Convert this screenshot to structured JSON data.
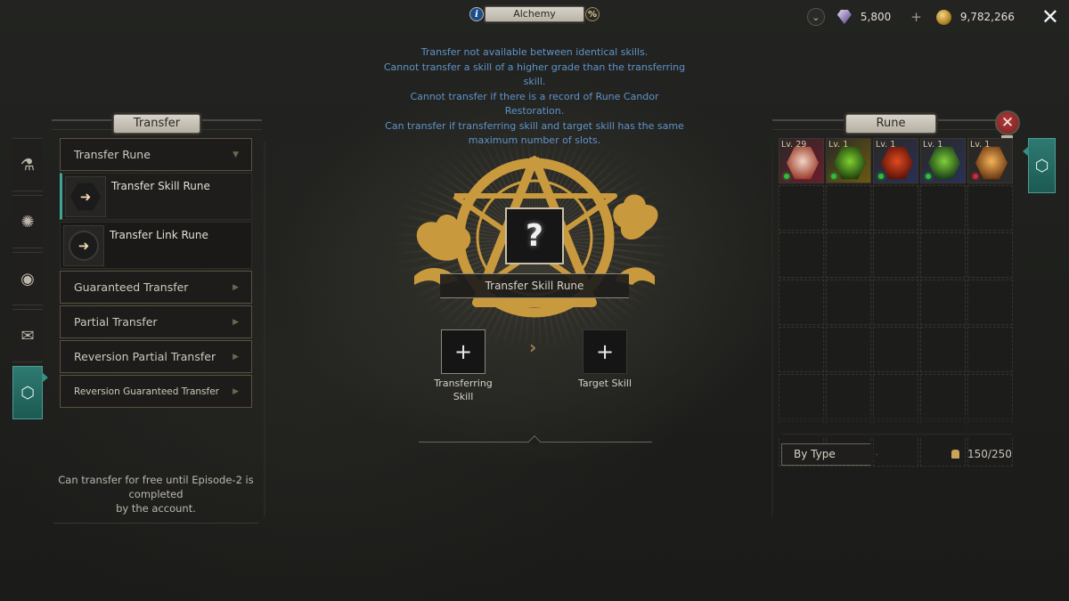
{
  "window": {
    "title": "Alchemy",
    "info_icon": "info-icon",
    "percent_icon": "percent-icon"
  },
  "currency": {
    "expand_icon": "chevron-down-icon",
    "gems": {
      "icon": "purple-gem-icon",
      "value": "5,800"
    },
    "add_label": "+",
    "gold": {
      "icon": "gold-coin-icon",
      "value": "9,782,266"
    },
    "close_label": "✕"
  },
  "notice": {
    "lines": [
      "Transfer not available between identical skills.",
      "Cannot transfer a skill of a higher grade than the transferring skill.",
      "Cannot transfer if there is a record of Rune Candor Restoration.",
      "Can transfer if transferring skill and target skill has the same maximum number of slots."
    ],
    "color": "#5f93c9"
  },
  "left_panel": {
    "title": "Transfer",
    "side_tabs": [
      {
        "name": "potion",
        "icon": "potion-icon",
        "glyph": "⚗",
        "active": false
      },
      {
        "name": "sun-rune",
        "icon": "sun-emblem-icon",
        "glyph": "✺",
        "active": false
      },
      {
        "name": "orb",
        "icon": "crystal-ball-icon",
        "glyph": "◉",
        "active": false
      },
      {
        "name": "scroll",
        "icon": "scroll-icon",
        "glyph": "✉",
        "active": false
      },
      {
        "name": "transfer",
        "icon": "transfer-hex-icon",
        "glyph": "⬡",
        "active": true
      }
    ],
    "category": {
      "label": "Transfer Rune",
      "arrow": "▼"
    },
    "sub_items": [
      {
        "label": "Transfer Skill Rune",
        "icon": "hex-arrow-icon",
        "glyph": "➜",
        "selected": true
      },
      {
        "label": "Transfer Link Rune",
        "icon": "round-arrow-icon",
        "glyph": "➜",
        "selected": false
      }
    ],
    "menu_items": [
      {
        "label": "Guaranteed Transfer",
        "arrow": "▶"
      },
      {
        "label": "Partial Transfer",
        "arrow": "▶"
      },
      {
        "label": "Reversion Partial Transfer",
        "arrow": "▶"
      },
      {
        "label": "Reversion Guaranteed Transfer",
        "arrow": "▶"
      }
    ],
    "free_note": [
      "Can transfer for free until Episode-2 is",
      "completed",
      "by the account."
    ]
  },
  "center": {
    "result_placeholder": "?",
    "result_name": "Transfer Skill Rune",
    "transferring_slot": {
      "label_lines": [
        "Transferring",
        "Skill"
      ],
      "plus": "+"
    },
    "arrow": "›",
    "target_slot": {
      "label": "Target Skill",
      "plus": "+"
    },
    "accent_color": "#c9993e"
  },
  "right_panel": {
    "title": "Rune",
    "close_label": "✕",
    "side_tab_icon": "rune-hex-icon",
    "runes": [
      {
        "level": "Lv. 29",
        "gem_colors": [
          "#f0d4c4",
          "#9b3a2a"
        ],
        "bg": "#6a1d2c",
        "status_color": "#2bbf3a"
      },
      {
        "level": "Lv. 1",
        "gem_colors": [
          "#7ed12e",
          "#1d3d10"
        ],
        "bg": "#6b5a12",
        "status_color": "#2bbf3a"
      },
      {
        "level": "Lv. 1",
        "gem_colors": [
          "#e04a20",
          "#5a1208"
        ],
        "bg": "#2a2f55",
        "status_color": "#2bbf3a"
      },
      {
        "level": "Lv. 1",
        "gem_colors": [
          "#7fcf3a",
          "#183a18"
        ],
        "bg": "#2a3058",
        "status_color": "#2bbf3a"
      },
      {
        "level": "Lv. 1",
        "gem_colors": [
          "#f3b35b",
          "#6a3510"
        ],
        "bg": "#2b2a28",
        "status_color": "#d0283a"
      }
    ],
    "empty_rows": 5,
    "sort_label": "By Type",
    "count_icon": "bag-icon",
    "count": "150/250"
  }
}
